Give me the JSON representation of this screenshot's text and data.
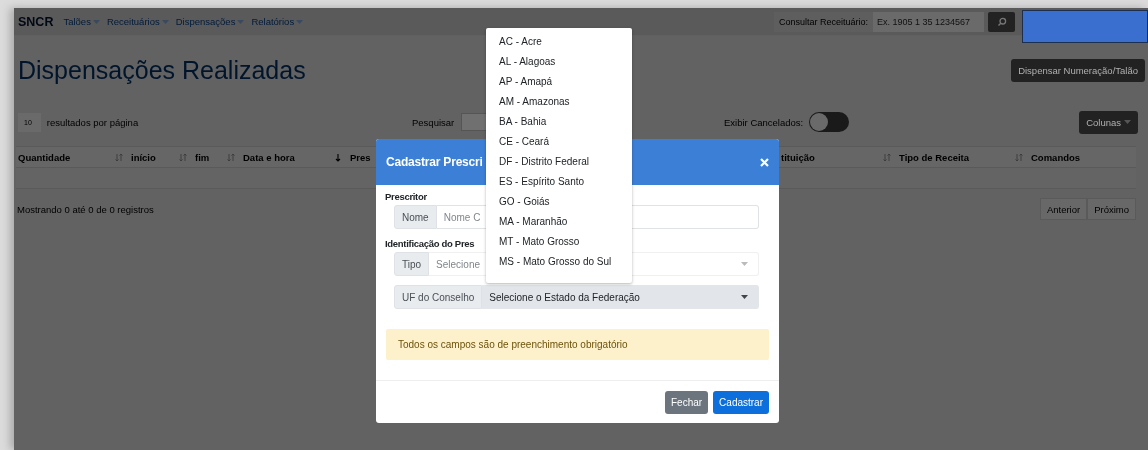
{
  "navbar": {
    "brand": "SNCR",
    "menus": [
      {
        "label": "Talões"
      },
      {
        "label": "Receituários"
      },
      {
        "label": "Dispensações"
      },
      {
        "label": "Relatórios"
      }
    ],
    "lookup": {
      "label": "Consultar Receituário:",
      "placeholder": "Ex. 1905 1 35 1234567"
    }
  },
  "page": {
    "title": "Dispensações Realizadas",
    "action_button": "Dispensar Numeração/Talão"
  },
  "table_controls": {
    "page_size": "10",
    "page_size_label": "resultados por página",
    "search_label": "Pesquisar",
    "show_cancelled": {
      "label": "Exibir Cancelados:",
      "on": false
    },
    "columns_button": "Colunas"
  },
  "table": {
    "columns": [
      {
        "label": "Quantidade",
        "sortable": true,
        "sorted_desc": false
      },
      {
        "label": "início",
        "sortable": true,
        "sorted_desc": false
      },
      {
        "label": "fim",
        "sortable": true,
        "sorted_desc": false
      },
      {
        "label": "Data e hora",
        "sortable": true,
        "sorted_desc": true
      },
      {
        "label": "Pres",
        "sortable": false,
        "sorted_desc": false
      },
      {
        "label": "tituição",
        "sortable": true,
        "sorted_desc": false
      },
      {
        "label": "Tipo de Receita",
        "sortable": true,
        "sorted_desc": false
      },
      {
        "label": "Comandos",
        "sortable": false,
        "sorted_desc": false
      }
    ],
    "info": "Mostrando 0 até 0 de 0 registros",
    "pagination": [
      "Anterior",
      "Próximo"
    ]
  },
  "modal": {
    "title": "Cadastrar Prescri",
    "sections": [
      {
        "heading": "Prescritor",
        "fields": [
          {
            "kind": "input",
            "label": "Nome",
            "placeholder": "Nome C",
            "open": false
          }
        ]
      },
      {
        "heading": "Identificação do Pres",
        "fields": [
          {
            "kind": "select",
            "label": "Tipo",
            "placeholder": "Selecione",
            "open": false
          },
          {
            "kind": "select",
            "label": "UF do Conselho",
            "value": "Selecione o Estado da Federação",
            "open": true
          }
        ]
      }
    ],
    "alert": "Todos os campos são de preenchimento obrigatório",
    "buttons": [
      {
        "label": "Fechar",
        "kind": "secondary"
      },
      {
        "label": "Cadastrar",
        "kind": "primary"
      }
    ]
  },
  "dropdown": {
    "options": [
      "AC - Acre",
      "AL - Alagoas",
      "AP - Amapá",
      "AM - Amazonas",
      "BA - Bahia",
      "CE - Ceará",
      "DF - Distrito Federal",
      "ES - Espírito Santo",
      "GO - Goiás",
      "MA - Maranhão",
      "MT - Mato Grosso",
      "MS - Mato Grosso do Sul"
    ]
  }
}
